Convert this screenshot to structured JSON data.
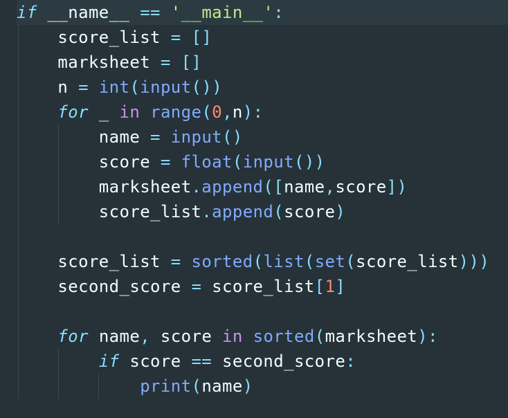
{
  "editor": {
    "language": "python",
    "colors": {
      "background": "#263238",
      "current_line": "#2c3b41",
      "text": "#eeffff",
      "keyword": "#89ddff",
      "keyword_alt": "#c792ea",
      "function": "#82aaff",
      "string": "#c3e88d",
      "number": "#f78c6c",
      "punctuation": "#89ddff"
    },
    "lines": [
      {
        "tokens": [
          [
            "kw",
            "if"
          ],
          [
            "id",
            " __name__ "
          ],
          [
            "op",
            "=="
          ],
          [
            "id",
            " "
          ],
          [
            "str",
            "'__main__'"
          ],
          [
            "pn",
            ":"
          ]
        ]
      },
      {
        "tokens": [
          [
            "id",
            "    score_list "
          ],
          [
            "op",
            "="
          ],
          [
            "id",
            " "
          ],
          [
            "pn",
            "[]"
          ]
        ]
      },
      {
        "tokens": [
          [
            "id",
            "    marksheet "
          ],
          [
            "op",
            "="
          ],
          [
            "id",
            " "
          ],
          [
            "pn",
            "[]"
          ]
        ]
      },
      {
        "tokens": [
          [
            "id",
            "    n "
          ],
          [
            "op",
            "="
          ],
          [
            "id",
            " "
          ],
          [
            "bi",
            "int"
          ],
          [
            "pn",
            "("
          ],
          [
            "bi",
            "input"
          ],
          [
            "pn",
            "())"
          ]
        ]
      },
      {
        "tokens": [
          [
            "id",
            "    "
          ],
          [
            "kw",
            "for"
          ],
          [
            "id",
            " _ "
          ],
          [
            "kw2",
            "in"
          ],
          [
            "id",
            " "
          ],
          [
            "bi",
            "range"
          ],
          [
            "pn",
            "("
          ],
          [
            "num",
            "0"
          ],
          [
            "pn",
            ","
          ],
          [
            "id",
            "n"
          ],
          [
            "pn",
            "):"
          ]
        ]
      },
      {
        "tokens": [
          [
            "id",
            "        name "
          ],
          [
            "op",
            "="
          ],
          [
            "id",
            " "
          ],
          [
            "bi",
            "input"
          ],
          [
            "pn",
            "()"
          ]
        ]
      },
      {
        "tokens": [
          [
            "id",
            "        score "
          ],
          [
            "op",
            "="
          ],
          [
            "id",
            " "
          ],
          [
            "bi",
            "float"
          ],
          [
            "pn",
            "("
          ],
          [
            "bi",
            "input"
          ],
          [
            "pn",
            "())"
          ]
        ]
      },
      {
        "tokens": [
          [
            "id",
            "        marksheet"
          ],
          [
            "pn",
            "."
          ],
          [
            "fn",
            "append"
          ],
          [
            "pn",
            "(["
          ],
          [
            "id",
            "name"
          ],
          [
            "pn",
            ","
          ],
          [
            "id",
            "score"
          ],
          [
            "pn",
            "])"
          ]
        ]
      },
      {
        "tokens": [
          [
            "id",
            "        score_list"
          ],
          [
            "pn",
            "."
          ],
          [
            "fn",
            "append"
          ],
          [
            "pn",
            "("
          ],
          [
            "id",
            "score"
          ],
          [
            "pn",
            ")"
          ]
        ]
      },
      {
        "tokens": []
      },
      {
        "tokens": [
          [
            "id",
            "    score_list "
          ],
          [
            "op",
            "="
          ],
          [
            "id",
            " "
          ],
          [
            "bi",
            "sorted"
          ],
          [
            "pn",
            "("
          ],
          [
            "bi",
            "list"
          ],
          [
            "pn",
            "("
          ],
          [
            "bi",
            "set"
          ],
          [
            "pn",
            "("
          ],
          [
            "id",
            "score_list"
          ],
          [
            "pn",
            ")))"
          ]
        ]
      },
      {
        "tokens": [
          [
            "id",
            "    second_score "
          ],
          [
            "op",
            "="
          ],
          [
            "id",
            " score_list"
          ],
          [
            "pn",
            "["
          ],
          [
            "num",
            "1"
          ],
          [
            "pn",
            "]"
          ]
        ]
      },
      {
        "tokens": []
      },
      {
        "tokens": [
          [
            "id",
            "    "
          ],
          [
            "kw",
            "for"
          ],
          [
            "id",
            " name"
          ],
          [
            "pn",
            ","
          ],
          [
            "id",
            " score "
          ],
          [
            "kw2",
            "in"
          ],
          [
            "id",
            " "
          ],
          [
            "bi",
            "sorted"
          ],
          [
            "pn",
            "("
          ],
          [
            "id",
            "marksheet"
          ],
          [
            "pn",
            "):"
          ]
        ]
      },
      {
        "tokens": [
          [
            "id",
            "        "
          ],
          [
            "kw",
            "if"
          ],
          [
            "id",
            " score "
          ],
          [
            "op",
            "=="
          ],
          [
            "id",
            " second_score"
          ],
          [
            "pn",
            ":"
          ]
        ]
      },
      {
        "tokens": [
          [
            "id",
            "            "
          ],
          [
            "bi",
            "print"
          ],
          [
            "pn",
            "("
          ],
          [
            "id",
            "name"
          ],
          [
            "pn",
            ")"
          ]
        ]
      }
    ]
  }
}
